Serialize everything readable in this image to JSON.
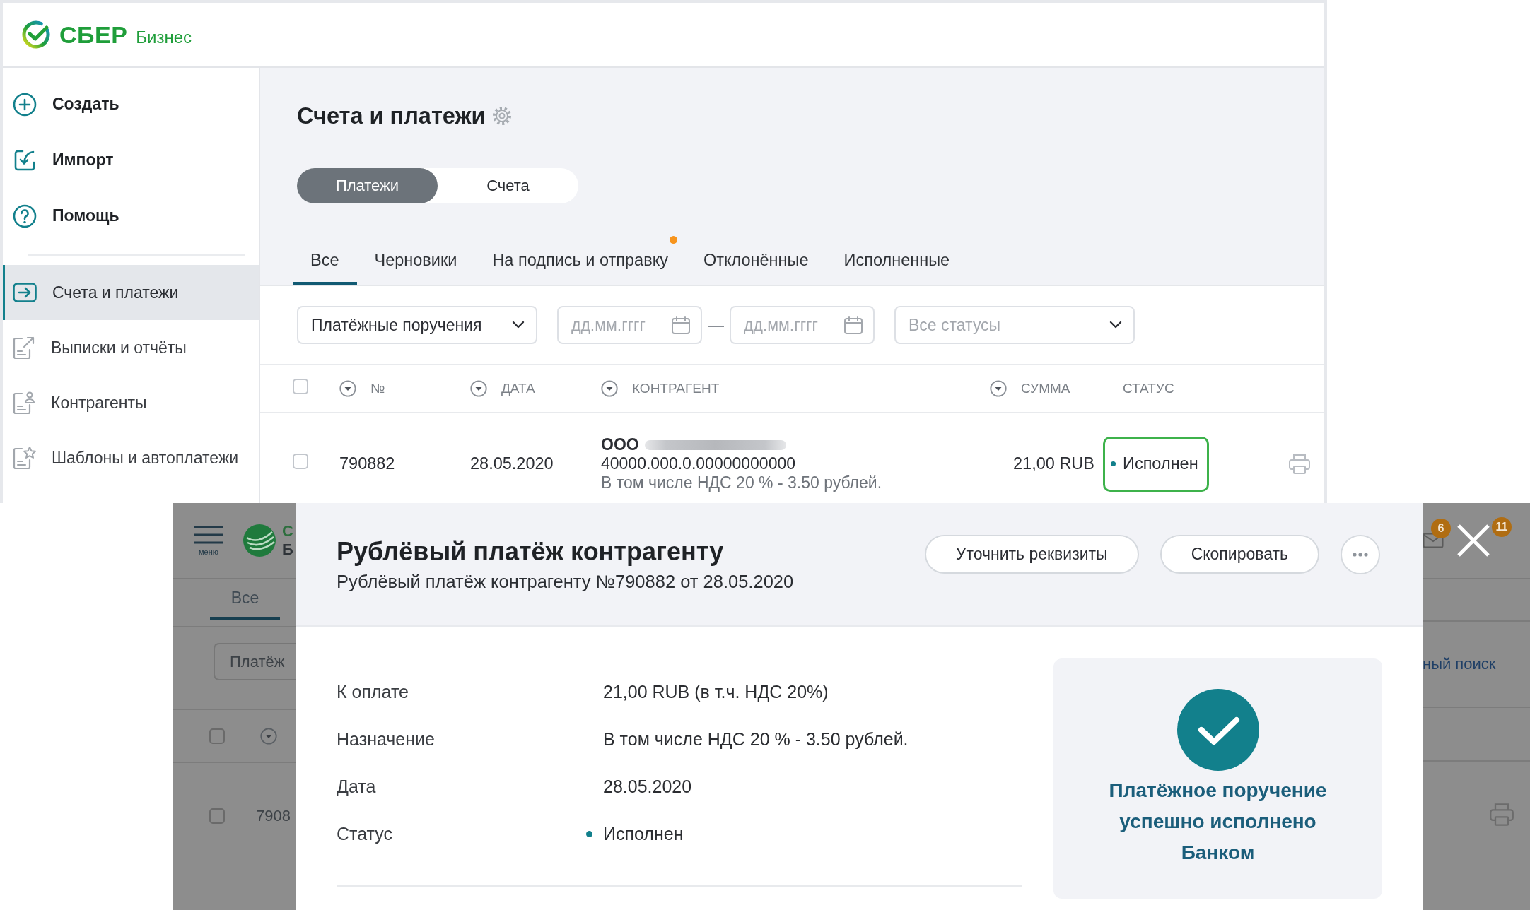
{
  "accounts_screen": {
    "logo": {
      "brand": "СБЕР",
      "product": "Бизнес"
    },
    "sidebar": {
      "actions": [
        {
          "label": "Создать"
        },
        {
          "label": "Импорт"
        },
        {
          "label": "Помощь"
        }
      ],
      "items": [
        {
          "label": "Счета и платежи",
          "selected": true
        },
        {
          "label": "Выписки и отчёты",
          "selected": false
        },
        {
          "label": "Контрагенты",
          "selected": false
        },
        {
          "label": "Шаблоны и автоплатежи",
          "selected": false
        }
      ]
    },
    "title": "Счета и платежи",
    "segments": [
      {
        "label": "Платежи",
        "selected": true
      },
      {
        "label": "Счета",
        "selected": false
      }
    ],
    "tabs": [
      {
        "label": "Все",
        "selected": true,
        "notification": false
      },
      {
        "label": "Черновики",
        "selected": false,
        "notification": false
      },
      {
        "label": "На подпись и отправку",
        "selected": false,
        "notification": true
      },
      {
        "label": "Отклонённые",
        "selected": false,
        "notification": false
      },
      {
        "label": "Исполненные",
        "selected": false,
        "notification": false
      }
    ],
    "filters": {
      "document_type": {
        "value": "Платёжные поручения"
      },
      "date_from": {
        "placeholder": "дд.мм.гггг"
      },
      "date_separator": "—",
      "date_to": {
        "placeholder": "дд.мм.гггг"
      },
      "status": {
        "placeholder": "Все статусы"
      }
    },
    "table": {
      "select_all": {
        "checked": false
      },
      "columns": [
        {
          "label": "№",
          "sortable": true
        },
        {
          "label": "ДАТА",
          "sortable": true
        },
        {
          "label": "КОНТРАГЕНТ",
          "sortable": true
        },
        {
          "label": "СУММА",
          "sortable": true
        },
        {
          "label": "СТАТУС",
          "sortable": false
        }
      ],
      "rows": [
        {
          "checked": false,
          "number": "790882",
          "date": "28.05.2020",
          "counterparty": {
            "legal_form": "ООО",
            "account": "40000.000.0.00000000000",
            "note": "В том числе НДС 20 % - 3.50 рублей."
          },
          "amount": "21,00 RUB",
          "status": "Исполнен",
          "highlighted": true
        }
      ]
    }
  },
  "payment_screen": {
    "background": {
      "menu_label": "меню",
      "logo_letters": [
        "С",
        "Б"
      ],
      "tab": {
        "label": "Все",
        "selected": true
      },
      "filter_value": "Платёж",
      "select_all": {
        "checked": false
      },
      "rows": [
        {
          "checked": false,
          "number": "7908"
        }
      ],
      "search_link": "ный поиск",
      "badges": [
        "6",
        "11"
      ]
    },
    "modal": {
      "title": "Рублёвый платёж контрагенту",
      "subtitle": "Рублёвый платёж контрагенту №790882 от 28.05.2020",
      "buttons": [
        {
          "label": "Уточнить реквизиты"
        },
        {
          "label": "Скопировать"
        }
      ],
      "details": [
        {
          "kind": "text",
          "label": "К оплате",
          "value": "21,00 RUB (в т.ч. НДС 20%)"
        },
        {
          "kind": "text",
          "label": "Назначение",
          "value": "В том числе НДС 20 % - 3.50 рублей."
        },
        {
          "kind": "text",
          "label": "Дата",
          "value": "28.05.2020"
        },
        {
          "kind": "status",
          "label": "Статус",
          "value": "Исполнен"
        }
      ],
      "success_message": "Платёжное поручение успешно исполнено Банком"
    }
  }
}
